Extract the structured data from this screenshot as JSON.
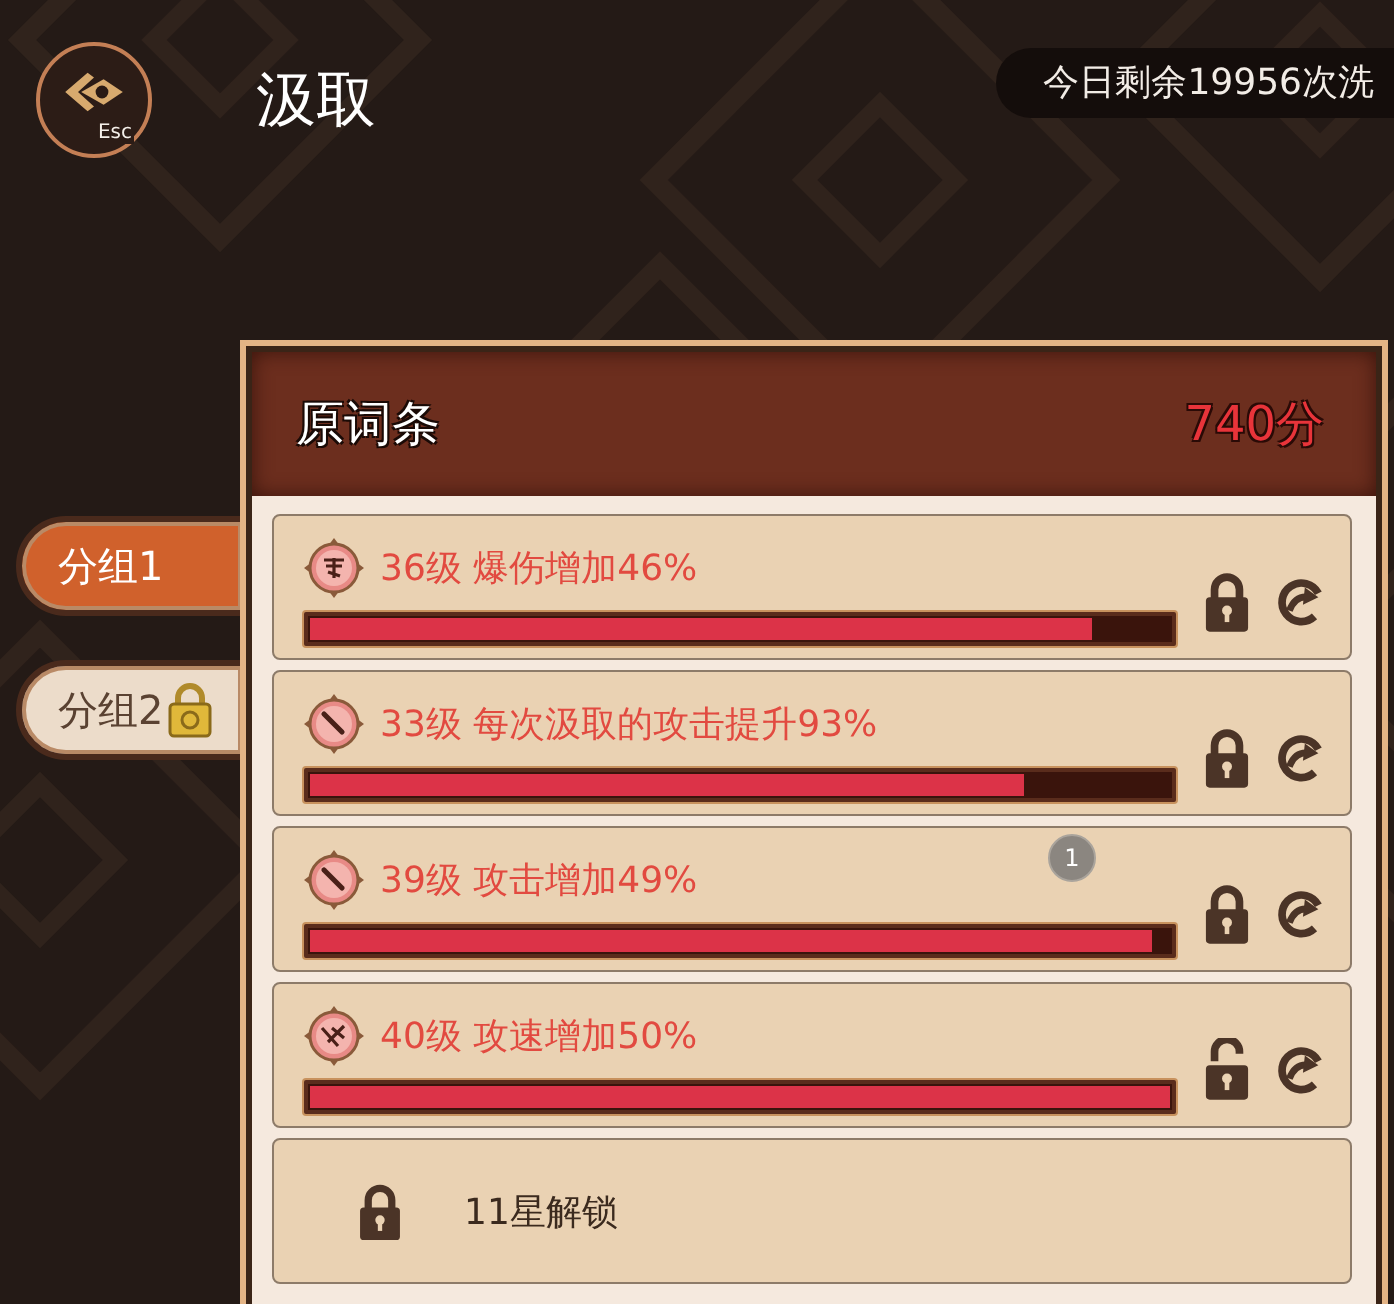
{
  "header": {
    "back_key": "Esc",
    "title": "汲取",
    "daily_counter": "今日剩余19956次洗"
  },
  "group_tabs": [
    {
      "label": "分组1",
      "selected": true,
      "locked": false
    },
    {
      "label": "分组2",
      "selected": false,
      "locked": true
    }
  ],
  "panel": {
    "title": "原词条",
    "score": "740分"
  },
  "affixes": [
    {
      "kind": "affix",
      "text": "36级 爆伤增加46%",
      "level": 0.91,
      "locked": true
    },
    {
      "kind": "affix",
      "text": "33级 每次汲取的攻击提升93%",
      "level": 0.83,
      "locked": true
    },
    {
      "kind": "affix",
      "text": "39级 攻击增加49%",
      "level": 0.98,
      "locked": true,
      "badge": "1"
    },
    {
      "kind": "affix",
      "text": "40级 攻速增加50%",
      "level": 1,
      "locked": false
    },
    {
      "kind": "sealed",
      "text": "11星解锁"
    }
  ]
}
